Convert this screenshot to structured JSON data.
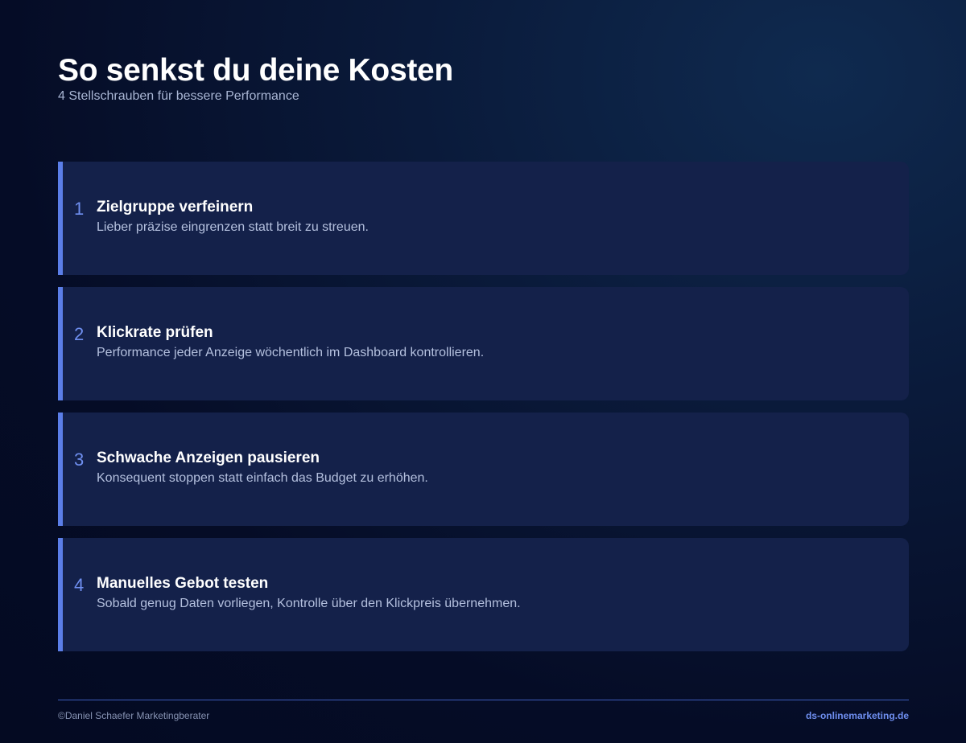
{
  "header": {
    "title": "So senkst du deine Kosten",
    "subtitle": "4 Stellschrauben für bessere Performance"
  },
  "cards": [
    {
      "number": "1",
      "title": "Zielgruppe verfeinern",
      "description": "Lieber präzise eingrenzen statt breit zu streuen."
    },
    {
      "number": "2",
      "title": "Klickrate prüfen",
      "description": "Performance jeder Anzeige wöchentlich im Dashboard kontrollieren."
    },
    {
      "number": "3",
      "title": "Schwache Anzeigen pausieren",
      "description": "Konsequent stoppen statt einfach das Budget zu erhöhen."
    },
    {
      "number": "4",
      "title": "Manuelles Gebot testen",
      "description": "Sobald genug Daten vorliegen, Kontrolle über den Klickpreis übernehmen."
    }
  ],
  "footer": {
    "copyright": "©Daniel Schaefer Marketingberater",
    "website": "ds-onlinemarketing.de"
  },
  "colors": {
    "accent": "#5b7ee8",
    "card_background": "#14214a",
    "page_background": "#050c26"
  }
}
